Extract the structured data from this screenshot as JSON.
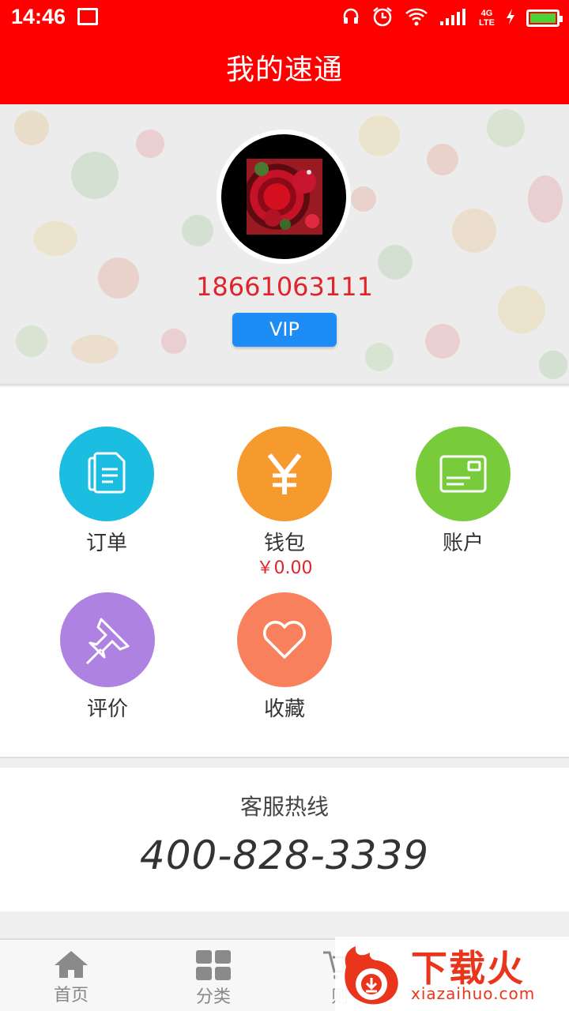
{
  "status_bar": {
    "time": "14:46",
    "network": "4G",
    "network_sub": "LTE"
  },
  "header": {
    "title": "我的速通"
  },
  "profile": {
    "phone": "18661063111",
    "vip_label": "VIP"
  },
  "menu": {
    "items": [
      {
        "label": "订单",
        "icon": "document-icon",
        "color": "#1bbde0"
      },
      {
        "label": "钱包",
        "sub": "￥0.00",
        "icon": "yen-icon",
        "color": "#f79a2e"
      },
      {
        "label": "账户",
        "icon": "card-icon",
        "color": "#78cc3c"
      },
      {
        "label": "评价",
        "icon": "pin-icon",
        "color": "#ae82e0"
      },
      {
        "label": "收藏",
        "icon": "heart-icon",
        "color": "#f8805c"
      }
    ]
  },
  "hotline": {
    "label": "客服热线",
    "number": "400-828-3339"
  },
  "bottom_nav": {
    "items": [
      {
        "label": "首页",
        "icon": "home-icon"
      },
      {
        "label": "分类",
        "icon": "grid-icon"
      },
      {
        "label": "则",
        "icon": "cart-icon"
      }
    ]
  },
  "watermark": {
    "text": "下载火",
    "domain": "xiazaihuo.com"
  },
  "colors": {
    "accent": "#ff0000",
    "vip": "#1e8cf5",
    "price": "#e0242b"
  }
}
